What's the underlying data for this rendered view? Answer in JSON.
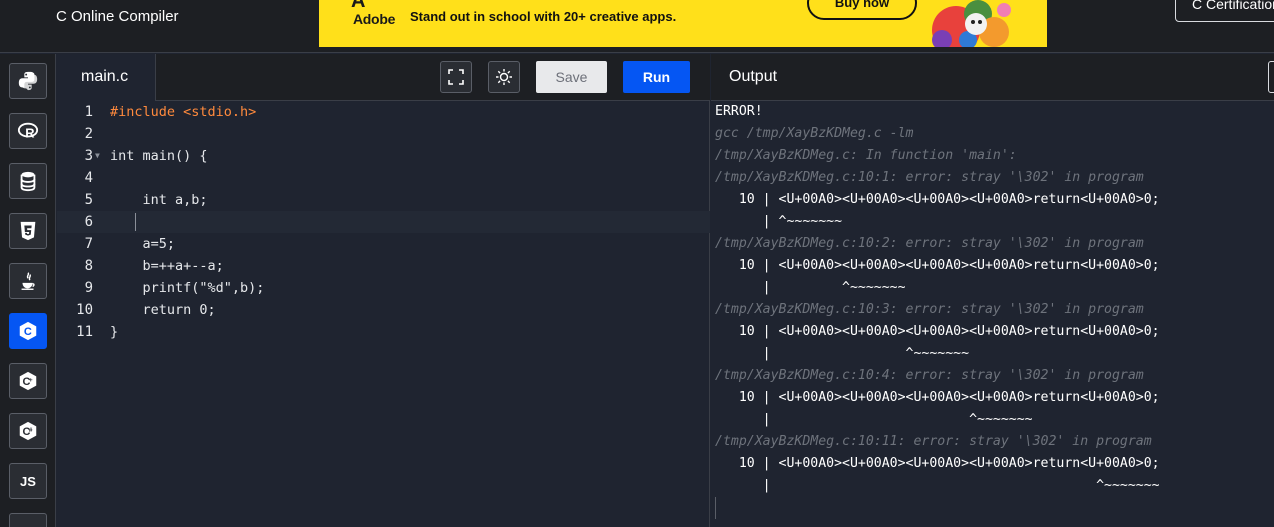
{
  "header": {
    "brand": "C Online Compiler",
    "ad": {
      "brand": "Adobe",
      "text": "Stand out in school with 20+ creative apps.",
      "cta": "Buy now"
    },
    "cert_button": "C Certification"
  },
  "sidebar": {
    "items": [
      {
        "name": "python",
        "icon": "python-icon"
      },
      {
        "name": "r",
        "icon": "r-icon"
      },
      {
        "name": "sql",
        "icon": "database-icon"
      },
      {
        "name": "html",
        "icon": "html5-icon"
      },
      {
        "name": "java",
        "icon": "java-icon"
      },
      {
        "name": "c",
        "icon": "c-icon",
        "active": true
      },
      {
        "name": "cpp",
        "icon": "cpp-icon"
      },
      {
        "name": "csharp",
        "icon": "csharp-icon"
      },
      {
        "name": "javascript",
        "icon": "js-icon",
        "label": "JS"
      }
    ]
  },
  "editor": {
    "file_tab": "main.c",
    "save_label": "Save",
    "run_label": "Run",
    "line_numbers": [
      "1",
      "2",
      "3",
      "4",
      "5",
      "6",
      "7",
      "8",
      "9",
      "10",
      "11"
    ],
    "lines": [
      "#include <stdio.h>",
      "",
      "int main() {",
      "",
      "    int a,b;",
      "",
      "    a=5;",
      "    b=++a+--a;",
      "    printf(\"%d\",b);",
      "    return 0;",
      "}"
    ]
  },
  "output": {
    "title": "Output",
    "lines": [
      "ERROR!",
      "gcc /tmp/XayBzKDMeg.c -lm",
      "/tmp/XayBzKDMeg.c: In function 'main':",
      "/tmp/XayBzKDMeg.c:10:1: error: stray '\\302' in program",
      "   10 | <U+00A0><U+00A0><U+00A0><U+00A0>return<U+00A0>0;",
      "      | ^~~~~~~~",
      "/tmp/XayBzKDMeg.c:10:2: error: stray '\\302' in program",
      "   10 | <U+00A0><U+00A0><U+00A0><U+00A0>return<U+00A0>0;",
      "      |         ^~~~~~~~",
      "/tmp/XayBzKDMeg.c:10:3: error: stray '\\302' in program",
      "   10 | <U+00A0><U+00A0><U+00A0><U+00A0>return<U+00A0>0;",
      "      |                 ^~~~~~~~",
      "/tmp/XayBzKDMeg.c:10:4: error: stray '\\302' in program",
      "   10 | <U+00A0><U+00A0><U+00A0><U+00A0>return<U+00A0>0;",
      "      |                         ^~~~~~~~",
      "/tmp/XayBzKDMeg.c:10:11: error: stray '\\302' in program",
      "   10 | <U+00A0><U+00A0><U+00A0><U+00A0>return<U+00A0>0;",
      "      |                                         ^~~~~~~~"
    ]
  },
  "colors": {
    "accent": "#0556f3",
    "ad_background": "#ffe01a",
    "editor_background": "#1f2430"
  }
}
